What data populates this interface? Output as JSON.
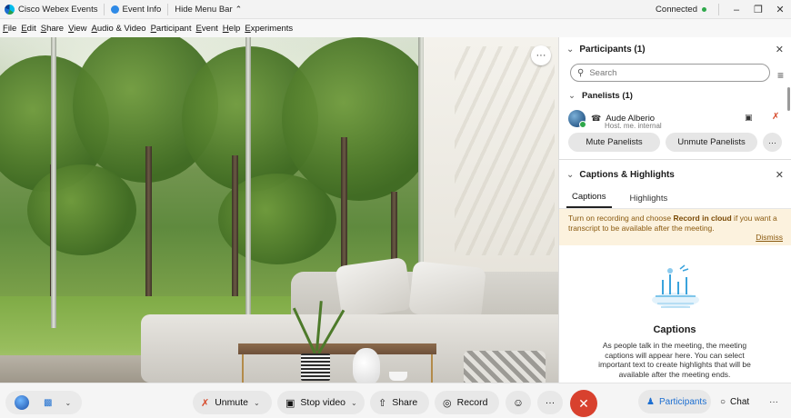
{
  "titlebar": {
    "app_name": "Cisco Webex Events",
    "event_info": "Event Info",
    "hide_menu": "Hide Menu Bar",
    "hide_menu_icon": "chevron-up-icon",
    "status": "Connected",
    "status_color": "#2ea84a",
    "window_controls": [
      "minimize-icon",
      "restore-icon",
      "close-icon"
    ]
  },
  "menubar": {
    "items": [
      "File",
      "Edit",
      "Share",
      "View",
      "Audio & Video",
      "Participant",
      "Event",
      "Help",
      "Experiments"
    ]
  },
  "participants_panel": {
    "title": "Participants (1)",
    "search_placeholder": "Search",
    "panelists_header": "Panelists (1)",
    "participant": {
      "name": "Aude Alberio",
      "role": "Host, me, internal",
      "avatar_status_color": "#2ea84a",
      "icons": [
        "headset-icon",
        "camera-icon",
        "mic-muted-icon"
      ]
    },
    "mute_panelists": "Mute Panelists",
    "unmute_panelists": "Unmute Panelists"
  },
  "captions_panel": {
    "title": "Captions & Highlights",
    "tabs": [
      "Captions",
      "Highlights"
    ],
    "active_tab": "Captions",
    "notice_prefix": "Turn on recording and choose ",
    "notice_bold": "Record in cloud",
    "notice_suffix": " if you want a transcript to be available after the meeting.",
    "dismiss": "Dismiss",
    "empty_title": "Captions",
    "empty_desc": "As people talk in the meeting, the meeting captions will appear here. You can select important text to create highlights that will be available after the meeting ends."
  },
  "toolbar": {
    "unmute": "Unmute",
    "stop_video": "Stop video",
    "share": "Share",
    "record": "Record",
    "participants": "Participants",
    "chat": "Chat",
    "accent_color": "#1d6fd1",
    "leave_color": "#d8412e"
  }
}
